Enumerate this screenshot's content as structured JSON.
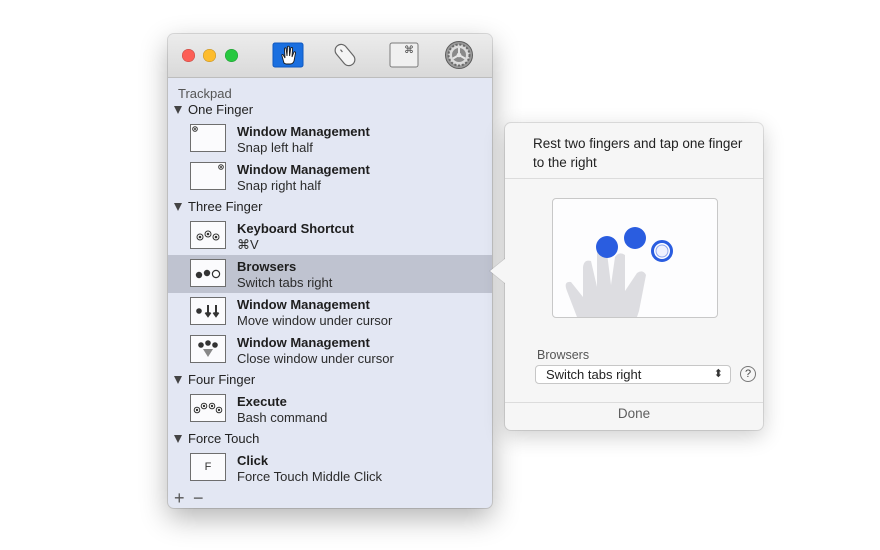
{
  "toolbar": {
    "tools": [
      {
        "icon": "trackpad-hand-icon",
        "active": true
      },
      {
        "icon": "mouse-icon",
        "active": false
      },
      {
        "icon": "keyboard-command-icon",
        "glyph": "⌘",
        "active": false
      },
      {
        "icon": "gear-icon",
        "active": false
      }
    ],
    "accent": "#1a6fe0"
  },
  "sidebar": {
    "section_title": "Trackpad",
    "groups": {
      "one_finger": "One Finger",
      "three_finger": "Three Finger",
      "four_finger": "Four Finger",
      "force_touch": "Force Touch"
    },
    "items": [
      {
        "title": "Window Management",
        "subtitle": "Snap left half"
      },
      {
        "title": "Window Management",
        "subtitle": "Snap right half"
      },
      {
        "title": "Keyboard Shortcut",
        "subtitle": "⌘V"
      },
      {
        "title": "Browsers",
        "subtitle": "Switch tabs right",
        "selected": true
      },
      {
        "title": "Window Management",
        "subtitle": "Move window under cursor"
      },
      {
        "title": "Window Management",
        "subtitle": "Close window under cursor"
      },
      {
        "title": "Execute",
        "subtitle": "Bash command"
      },
      {
        "title": "Click",
        "subtitle": "Force Touch Middle Click",
        "thumb_glyph": "F"
      }
    ],
    "add_label": "+",
    "remove_label": "−"
  },
  "popover": {
    "description": "Rest two fingers and tap one finger to the right",
    "app_label": "Browsers",
    "action_value": "Switch tabs right",
    "help_label": "?",
    "done_label": "Done",
    "finger_color": "#2a5de0"
  }
}
